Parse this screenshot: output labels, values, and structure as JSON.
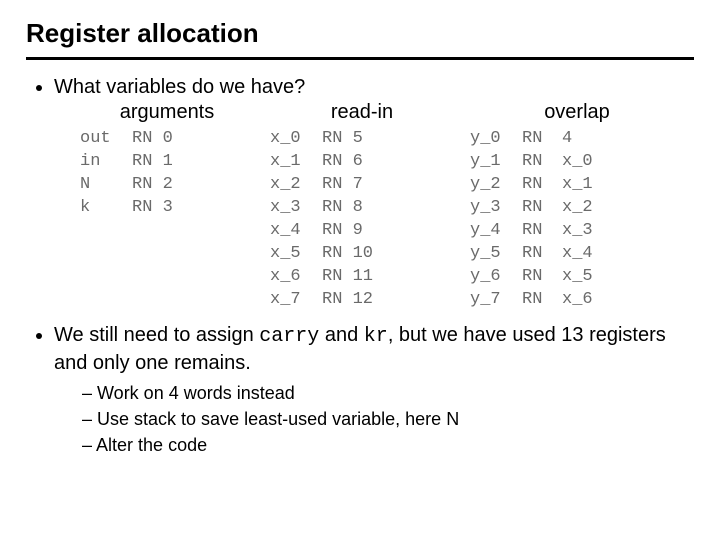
{
  "title": "Register allocation",
  "bullet1": "What variables do we have?",
  "labels": {
    "args": "arguments",
    "readin": "read-in",
    "overlap": "overlap"
  },
  "args": [
    {
      "v": "out",
      "r": "RN 0"
    },
    {
      "v": "in",
      "r": "RN 1"
    },
    {
      "v": "N",
      "r": "RN 2"
    },
    {
      "v": "k",
      "r": "RN 3"
    }
  ],
  "readin": [
    {
      "v": "x_0",
      "r": "RN 5"
    },
    {
      "v": "x_1",
      "r": "RN 6"
    },
    {
      "v": "x_2",
      "r": "RN 7"
    },
    {
      "v": "x_3",
      "r": "RN 8"
    },
    {
      "v": "x_4",
      "r": "RN 9"
    },
    {
      "v": "x_5",
      "r": "RN 10"
    },
    {
      "v": "x_6",
      "r": "RN 11"
    },
    {
      "v": "x_7",
      "r": "RN 12"
    }
  ],
  "overlap": [
    {
      "v": "y_0",
      "r": "RN 4"
    },
    {
      "v": "y_1",
      "r": "RN x_0"
    },
    {
      "v": "y_2",
      "r": "RN x_1"
    },
    {
      "v": "y_3",
      "r": "RN x_2"
    },
    {
      "v": "y_4",
      "r": "RN x_3"
    },
    {
      "v": "y_5",
      "r": "RN x_4"
    },
    {
      "v": "y_6",
      "r": "RN x_5"
    },
    {
      "v": "y_7",
      "r": "RN x_6"
    }
  ],
  "bullet2": {
    "pre": "We still need to assign ",
    "code1": "carry",
    "mid": " and ",
    "code2": "kr",
    "post": ", but we have used 13 registers and only one remains."
  },
  "subs": [
    "Work on 4 words instead",
    "Use stack to save least-used variable, here N",
    "Alter the code"
  ]
}
